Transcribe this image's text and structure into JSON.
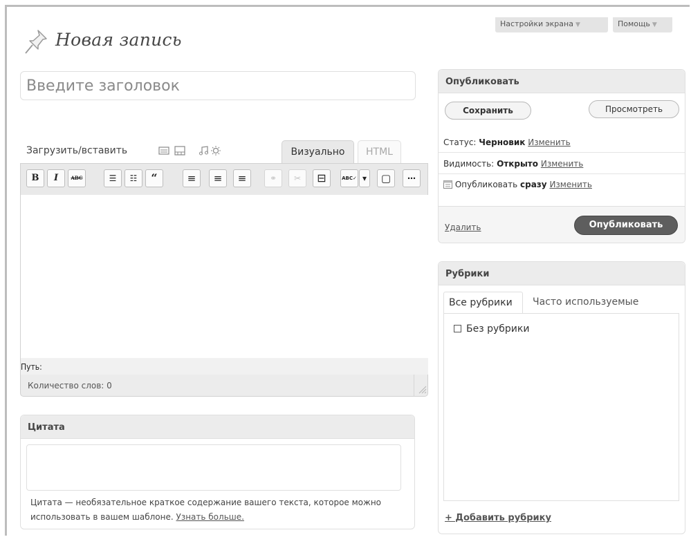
{
  "header": {
    "title": "Новая запись",
    "screen_options": "Настройки экрана",
    "help": "Помощь"
  },
  "post": {
    "title_placeholder": "Введите заголовок"
  },
  "media": {
    "label": "Загрузить/вставить",
    "icons": [
      "image-icon",
      "video-icon",
      "audio-icon",
      "media-gallery-icon"
    ]
  },
  "editor": {
    "tab_visual": "Визуально",
    "tab_html": "HTML",
    "toolbar": [
      {
        "name": "bold-button",
        "glyph": "B"
      },
      {
        "name": "italic-button",
        "glyph": "I"
      },
      {
        "name": "strikethrough-button",
        "glyph": "ABC"
      },
      {
        "name": "bullet-list-button",
        "glyph": "☰"
      },
      {
        "name": "numbered-list-button",
        "glyph": "☷"
      },
      {
        "name": "blockquote-button",
        "glyph": "“"
      },
      {
        "name": "align-left-button",
        "glyph": "≡"
      },
      {
        "name": "align-center-button",
        "glyph": "≡"
      },
      {
        "name": "align-right-button",
        "glyph": "≡"
      },
      {
        "name": "insert-link-button",
        "glyph": "⚭"
      },
      {
        "name": "remove-link-button",
        "glyph": "✂"
      },
      {
        "name": "more-tag-button",
        "glyph": "⊟"
      },
      {
        "name": "spellcheck-button",
        "glyph": "ABC✓"
      },
      {
        "name": "spellcheck-dropdown-button",
        "glyph": "▾"
      },
      {
        "name": "fullscreen-button",
        "glyph": "▢"
      },
      {
        "name": "kitchen-sink-button",
        "glyph": "⋯"
      }
    ],
    "path_label": "Путь:",
    "word_count": "Количество слов: 0"
  },
  "excerpt": {
    "title": "Цитата",
    "help_text": "Цитата — необязательное краткое содержание вашего текста, которое можно использовать в вашем шаблоне.",
    "learn_more": "Узнать больше."
  },
  "publish": {
    "title": "Опубликовать",
    "save": "Сохранить",
    "preview": "Просмотреть",
    "status_label": "Статус:",
    "status_value": "Черновик",
    "visibility_label": "Видимость:",
    "visibility_value": "Открыто",
    "schedule_label": "Опубликовать",
    "schedule_value": "сразу",
    "edit": "Изменить",
    "delete": "Удалить",
    "publish_button": "Опубликовать"
  },
  "categories": {
    "title": "Рубрики",
    "tab_all": "Все рубрики",
    "tab_popular": "Часто используемые",
    "items": [
      {
        "label": "Без рубрики",
        "checked": false
      }
    ],
    "add_new": "+ Добавить рубрику"
  }
}
